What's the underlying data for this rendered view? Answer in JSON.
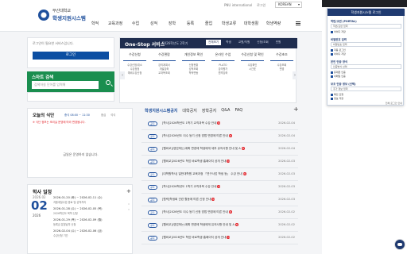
{
  "header": {
    "logo_line1": "부산대학교",
    "logo_line2": "학생지원시스템",
    "top_links": [
      "PNU international",
      "로그인"
    ],
    "language": "KOREAN",
    "nav": [
      "학적",
      "교육과정",
      "수업",
      "성적",
      "장학",
      "등록",
      "졸업",
      "학생교류",
      "대학생활",
      "학생역량"
    ]
  },
  "login": {
    "message": "로그인이 필요한 서비스입니다.",
    "button": "로그인"
  },
  "smart_search": {
    "title": "스마트 검색",
    "placeholder": "검색하실 단어를 입력해"
  },
  "onestop": {
    "title": "One-Stop 서비스",
    "year": "2026학년도 2학기",
    "tabs": [
      "전체보기",
      "학생",
      "교원/직원",
      "신청/조회",
      "민원"
    ],
    "columns": [
      {
        "head": "수강신청",
        "items": [
          "수강신청/취소",
          "수강정정",
          "예비수강신청"
        ]
      },
      {
        "head": "수강편람",
        "items": [
          "강의계획서",
          "개설강좌",
          "교과목조회"
        ]
      },
      {
        "head": "개인정보 확인",
        "items": [
          "신청현황",
          "성적조회",
          "학적변동"
        ]
      },
      {
        "head": "온라인 수업",
        "items": [
          "PLATO",
          "강의평가",
          "원격강좌"
        ]
      },
      {
        "head": "수강신청 및 확인",
        "items": [
          "수강확인",
          "시간표"
        ]
      },
      {
        "head": "수강초조",
        "items": [
          "수강조회",
          "변경"
        ]
      }
    ]
  },
  "notices": {
    "tabs": [
      "학생지원시스템공지",
      "대학공지",
      "장학공지",
      "Q&A",
      "FAQ"
    ],
    "badge": "공지",
    "items": [
      {
        "title": "[학사]2026학년도 1학기 교직과목 수강 안내",
        "date": "2026-02-04"
      },
      {
        "title": "[학사]2026년도 이수 등기 신청 방법 변경에 따른 안내",
        "date": "2026-02-04"
      },
      {
        "title": "[웹비교](영업하는)계획 변경에 학생에게 세부 유의사항 안내 및 A",
        "date": "2026-02-04"
      },
      {
        "title": "[웹비교]2026년도 학업 바로학생 홈페이지 공개 안내",
        "date": "2026-02-03"
      },
      {
        "title": "[대학원학사] 일반대학원 교육과정 「연구사업 학생 등」 수강 안내",
        "date": "2026-02-03"
      },
      {
        "title": "[학사]2026학년도 1학기 교직과목 수강 안내",
        "date": "2026-02-03"
      },
      {
        "title": "[협력]학생회 관련 활동에 따른 신청 안내",
        "date": "2026-02-03"
      },
      {
        "title": "[학사]2026년도 이수 등기 신청 방법 변경에 따른 안내",
        "date": "2026-02-02"
      },
      {
        "title": "[웹비교](영업하는)계획 변경에 학생에게 유의사항 안내 및 A",
        "date": "2026-02-02"
      },
      {
        "title": "[웹비교]2026년도 학업 바로학생 홈페이지 공개 안내",
        "date": "2026-02-02"
      }
    ]
  },
  "meal": {
    "title": "오늘의 식단",
    "time": "중식 08:00 ~ 11:30",
    "tabs": [
      "점심",
      "석식"
    ],
    "warning": "※ 식단 정보는 조리실 운영에 따라 변경됩니다.",
    "empty": "금일은 운영하지 않습니다."
  },
  "schedule": {
    "title": "학사 일정",
    "month": "2026.02",
    "day": "02",
    "year": "2026",
    "items": [
      {
        "date": "2026-01-20 (화) ~ 2026-02-11 (수)",
        "text": "겨울계절수업 종료 및 성적처리"
      },
      {
        "date": "2026-01-28 (수) ~ 2026-02-05 (목)",
        "text": "2026학년도 복학 신청"
      },
      {
        "date": "2026-01-29 (목) ~ 2026-02-09 (월)",
        "text": "등록금 분할납부 신청"
      },
      {
        "date": "2026-02-04 (수) ~ 2026-02-06 (금)",
        "text": "수강신청 기간"
      }
    ]
  },
  "popup": {
    "title": "학생지원시스템 로그인",
    "sections": [
      {
        "label": "학번/교번 (PORTAL)",
        "field": "학번/교번 입력",
        "checks": [
          "아이디 저장"
        ]
      },
      {
        "label": "비밀번호 입력",
        "field": "비밀번호 입력",
        "checks": [
          "자동 로그인",
          "아이디 저장"
        ]
      },
      {
        "label": "본인 인증 방식",
        "field": "인증방식 선택",
        "checks": [
          "휴대폰 인증",
          "이메일 인증"
        ]
      },
      {
        "label": "보조 인증 정보 (선택)",
        "field": "추가 정보 입력",
        "checks": [
          "확인 요청",
          "정보 저장"
        ]
      }
    ],
    "footer": "전체 로그인 안내"
  }
}
